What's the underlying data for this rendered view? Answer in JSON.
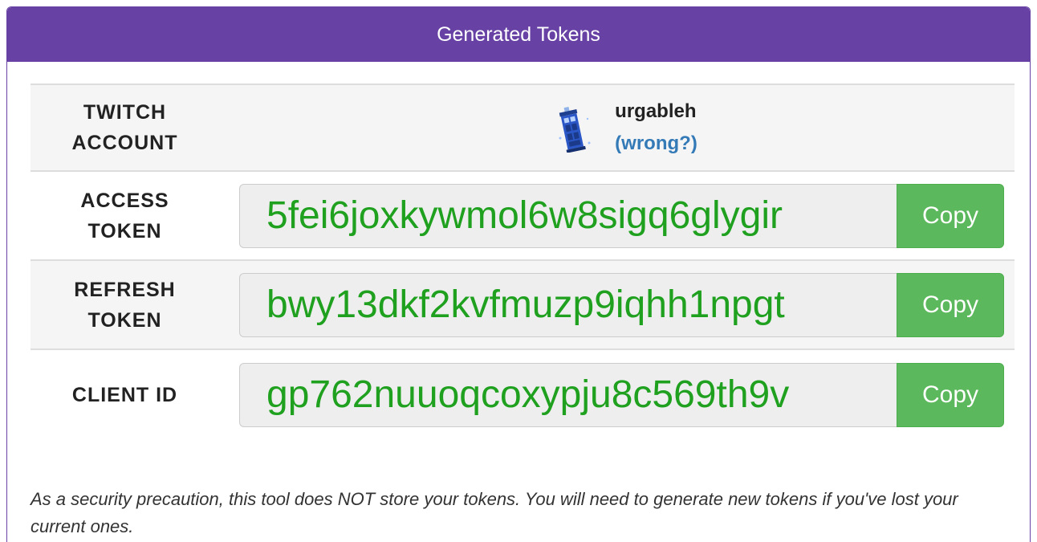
{
  "panel": {
    "title": "Generated Tokens"
  },
  "account": {
    "label_line1": "TWITCH",
    "label_line2": "ACCOUNT",
    "username": "urgableh",
    "wrong_link": "(wrong?)",
    "avatar_icon": "tardis-avatar-icon"
  },
  "tokens": [
    {
      "label_line1": "ACCESS",
      "label_line2": "TOKEN",
      "value": "5fei6joxkywmol6w8sigq6glygir",
      "copy_label": "Copy"
    },
    {
      "label_line1": "REFRESH",
      "label_line2": "TOKEN",
      "value": "bwy13dkf2kvfmuzp9iqhh1npgt",
      "copy_label": "Copy"
    },
    {
      "label_line1": "CLIENT ID",
      "label_line2": "",
      "value": "gp762nuuoqcoxypju8c569th9v",
      "copy_label": "Copy"
    }
  ],
  "notice": "As a security precaution, this tool does NOT store your tokens. You will need to generate new tokens if you've lost your current ones.",
  "colors": {
    "header": "#6741a4",
    "token_text": "#1fa11f",
    "copy_button": "#5cb85c",
    "link": "#337ab7"
  }
}
